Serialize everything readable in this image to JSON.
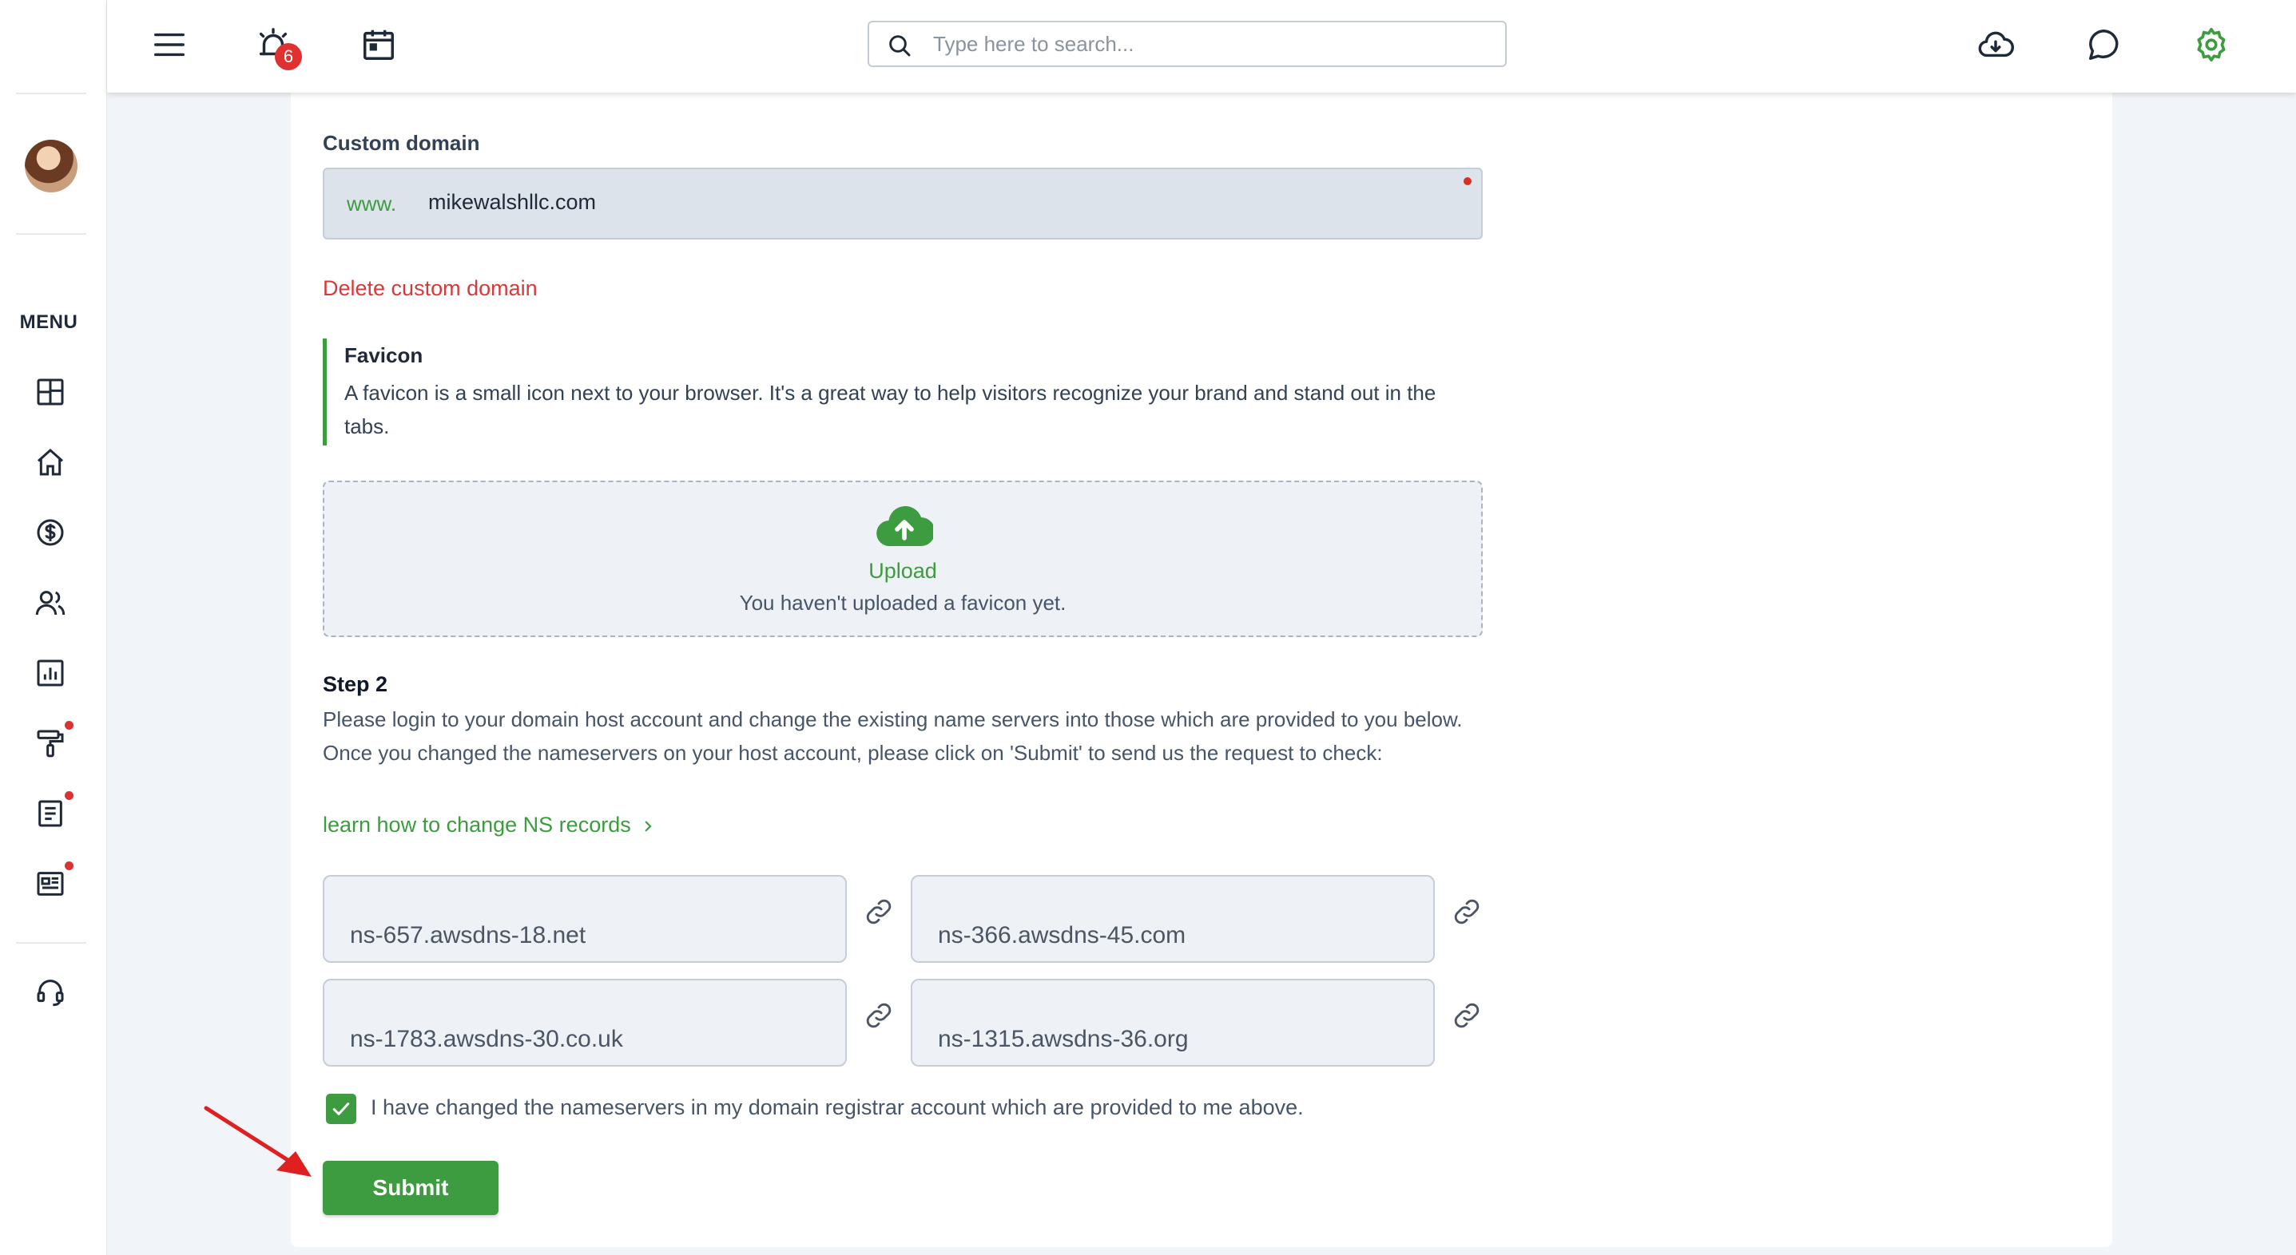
{
  "header": {
    "notification_count": "6",
    "search_placeholder": "Type here to search..."
  },
  "sidebar": {
    "menu_label": "MENU",
    "items": [
      {
        "icon": "dashboard-icon"
      },
      {
        "icon": "home-icon"
      },
      {
        "icon": "dollar-icon"
      },
      {
        "icon": "users-icon"
      },
      {
        "icon": "chart-icon"
      },
      {
        "icon": "paint-roller-icon",
        "dot": true
      },
      {
        "icon": "document-icon",
        "dot": true
      },
      {
        "icon": "newspaper-icon",
        "dot": true
      },
      {
        "icon": "support-icon"
      }
    ]
  },
  "custom_domain": {
    "label": "Custom domain",
    "prefix": "www.",
    "value": "mikewalshllc.com",
    "delete_label": "Delete custom domain"
  },
  "favicon": {
    "title": "Favicon",
    "description": "A favicon is a small icon next to your browser. It's a great way to help visitors recognize your brand and stand out in the tabs.",
    "upload_label": "Upload",
    "upload_hint": "You haven't uploaded a favicon yet."
  },
  "step2": {
    "title": "Step 2",
    "description": "Please login to your domain host account and change the existing name servers into those which are provided to you below. Once you changed the nameservers on your host account, please click on 'Submit' to send us the request to check:",
    "learn_link": "learn how to change NS records",
    "nameservers": [
      "ns-657.awsdns-18.net",
      "ns-366.awsdns-45.com",
      "ns-1783.awsdns-30.co.uk",
      "ns-1315.awsdns-36.org"
    ],
    "confirm_label": "I have changed the nameservers in my domain registrar account which are provided to me above.",
    "confirm_checked": true,
    "submit_label": "Submit"
  },
  "colors": {
    "accent_green": "#3d9c3f",
    "danger_red": "#d63a3a",
    "annotation_red": "#e02020"
  }
}
